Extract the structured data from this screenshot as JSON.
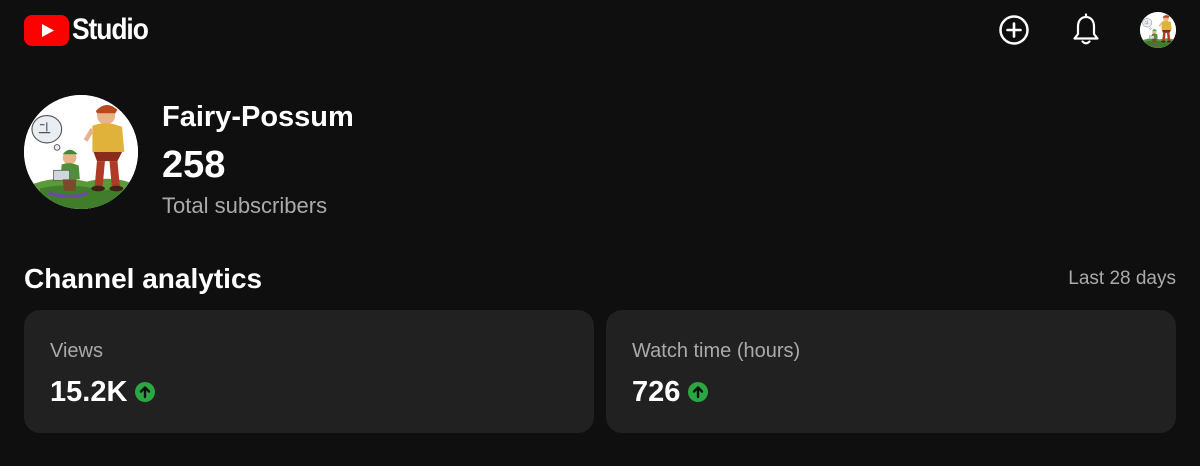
{
  "header": {
    "logo_text": "Studio",
    "icons": {
      "logo": "youtube-play-logo",
      "create": "add-circle-icon",
      "notifications": "bell-icon",
      "account": "account-avatar"
    },
    "brand_color": "#ff0000"
  },
  "channel": {
    "name": "Fairy-Possum",
    "subscriber_count": "258",
    "subscriber_label": "Total subscribers"
  },
  "analytics": {
    "title": "Channel analytics",
    "period": "Last 28 days",
    "cards": [
      {
        "label": "Views",
        "value": "15.2K",
        "trend": "up",
        "trend_icon": "arrow-up-circle-icon"
      },
      {
        "label": "Watch time (hours)",
        "value": "726",
        "trend": "up",
        "trend_icon": "arrow-up-circle-icon"
      }
    ],
    "trend_color": "#2ba640"
  },
  "colors": {
    "background": "#0f0f0f",
    "card_background": "#212121",
    "secondary_text": "#aaaaaa"
  }
}
